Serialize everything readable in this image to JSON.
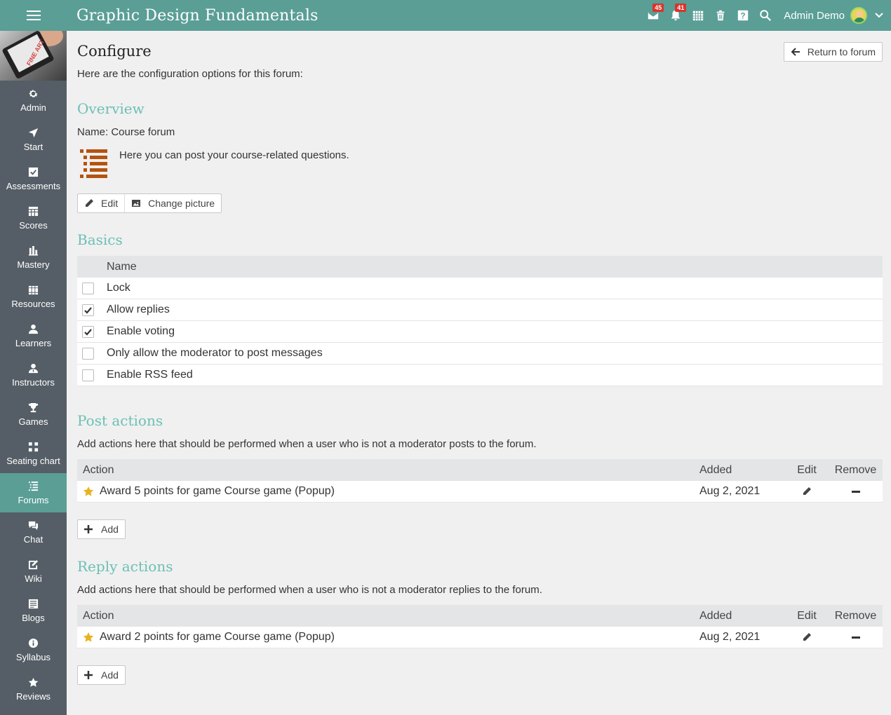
{
  "app": {
    "title": "Graphic Design Fundamentals",
    "user_name": "Admin Demo",
    "badges": {
      "messages": "45",
      "notifications": "41"
    },
    "accent_color": "#5a9e96",
    "sidebar_color": "#555e66"
  },
  "course_image_text": "FINE ART",
  "sidebar": {
    "items": [
      {
        "label": "Admin",
        "icon": "gear-icon"
      },
      {
        "label": "Start",
        "icon": "location-arrow-icon"
      },
      {
        "label": "Assessments",
        "icon": "checkbox-icon"
      },
      {
        "label": "Scores",
        "icon": "grid-icon"
      },
      {
        "label": "Mastery",
        "icon": "bar-chart-icon"
      },
      {
        "label": "Resources",
        "icon": "books-icon"
      },
      {
        "label": "Learners",
        "icon": "user-icon"
      },
      {
        "label": "Instructors",
        "icon": "instructor-icon"
      },
      {
        "label": "Games",
        "icon": "trophy-icon"
      },
      {
        "label": "Seating chart",
        "icon": "seating-icon"
      },
      {
        "label": "Forums",
        "icon": "list-icon"
      },
      {
        "label": "Chat",
        "icon": "chat-icon"
      },
      {
        "label": "Wiki",
        "icon": "edit-doc-icon"
      },
      {
        "label": "Blogs",
        "icon": "blog-icon"
      },
      {
        "label": "Syllabus",
        "icon": "info-icon"
      },
      {
        "label": "Reviews",
        "icon": "star-icon"
      }
    ],
    "active": "Forums"
  },
  "page": {
    "title": "Configure",
    "return_label": "Return to forum",
    "intro": "Here are the configuration options for this forum:"
  },
  "overview": {
    "heading": "Overview",
    "name_line": "Name: Course forum",
    "description": "Here you can post your course-related questions.",
    "edit_label": "Edit",
    "change_picture_label": "Change picture"
  },
  "basics": {
    "heading": "Basics",
    "column": "Name",
    "options": [
      {
        "label": "Lock",
        "checked": false
      },
      {
        "label": "Allow replies",
        "checked": true
      },
      {
        "label": "Enable voting",
        "checked": true
      },
      {
        "label": "Only allow the moderator to post messages",
        "checked": false
      },
      {
        "label": "Enable RSS feed",
        "checked": false
      }
    ]
  },
  "post_actions": {
    "heading": "Post actions",
    "description": "Add actions here that should be performed when a user who is not a moderator posts to the forum.",
    "columns": {
      "action": "Action",
      "added": "Added",
      "edit": "Edit",
      "remove": "Remove"
    },
    "rows": [
      {
        "action": "Award 5 points for game Course game (Popup)",
        "added": "Aug 2, 2021"
      }
    ],
    "add_label": "Add"
  },
  "reply_actions": {
    "heading": "Reply actions",
    "description": "Add actions here that should be performed when a user who is not a moderator replies to the forum.",
    "columns": {
      "action": "Action",
      "added": "Added",
      "edit": "Edit",
      "remove": "Remove"
    },
    "rows": [
      {
        "action": "Award 2 points for game Course game (Popup)",
        "added": "Aug 2, 2021"
      }
    ],
    "add_label": "Add"
  }
}
